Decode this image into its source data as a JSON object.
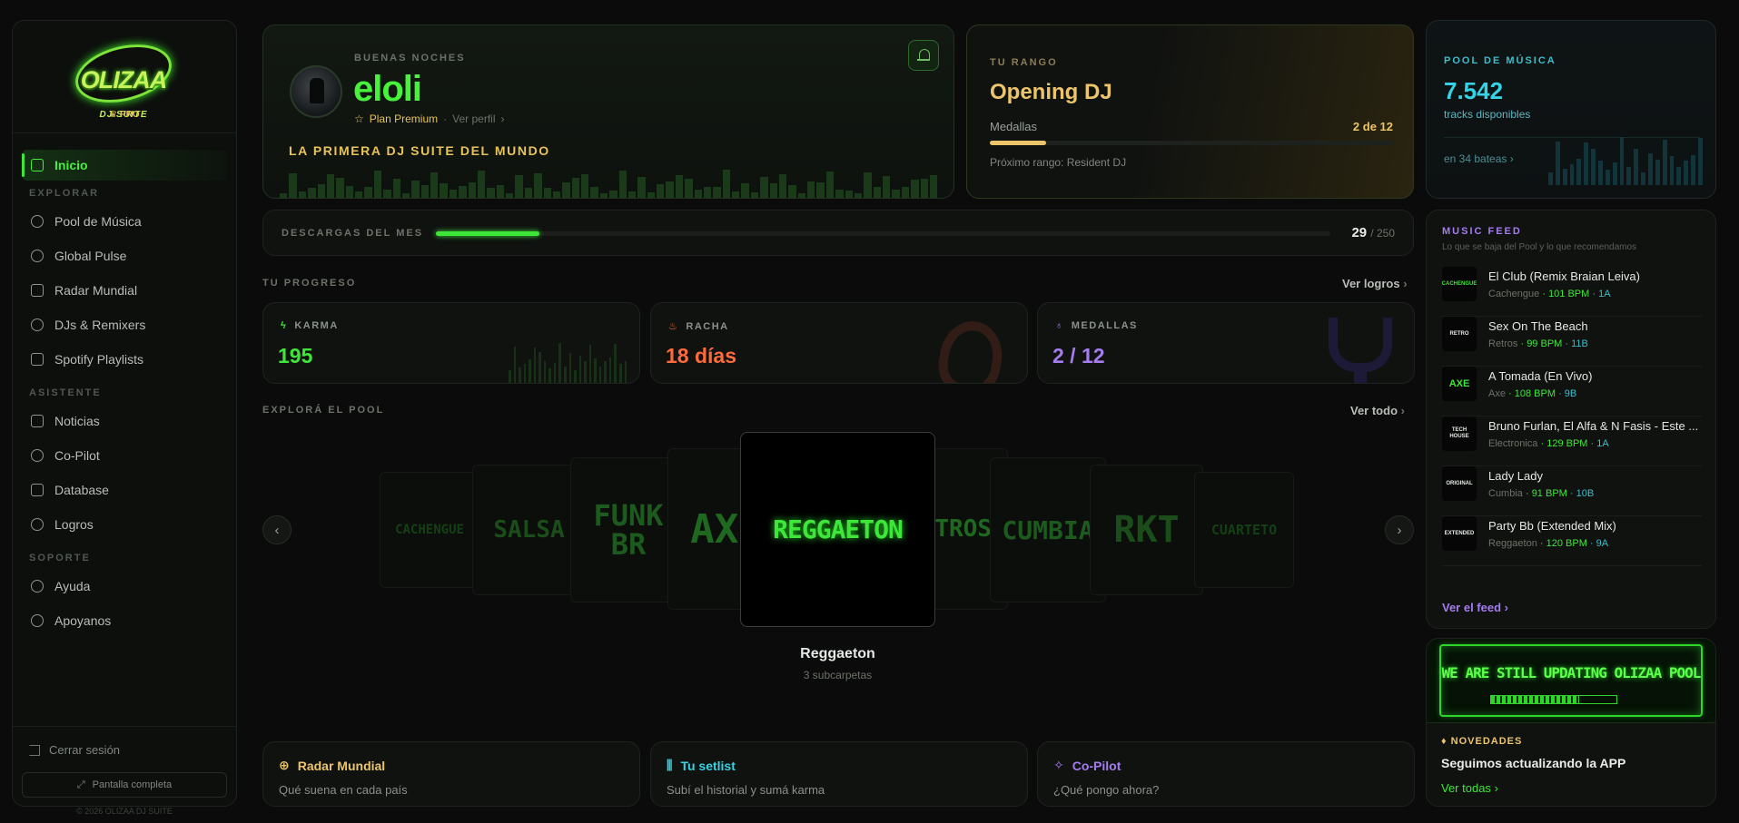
{
  "brand": {
    "logo_text": "OLIZAA",
    "logo_sub": "DJ SUITE",
    "tier": "♛ PRO"
  },
  "sidebar": {
    "active_item": "Inicio",
    "sections": {
      "explore": "EXPLORAR",
      "assistant": "ASISTENTE",
      "support": "SOPORTE"
    },
    "explore_items": [
      "Pool de Música",
      "Global Pulse",
      "Radar Mundial",
      "DJs & Remixers",
      "Spotify Playlists"
    ],
    "assistant_items": [
      "Noticias",
      "Co-Pilot",
      "Database",
      "Logros"
    ],
    "support_items": [
      "Ayuda",
      "Apoyanos"
    ],
    "logout": "Cerrar sesión",
    "fullscreen": "Pantalla completa",
    "copyright": "© 2026 OLIZAA DJ SUITE"
  },
  "hero": {
    "greeting": "BUENAS NOCHES",
    "username": "eloli",
    "plan": "Plan Premium",
    "plan_separator": "·",
    "profile_link": "Ver perfil",
    "tagline": "LA PRIMERA DJ SUITE DEL MUNDO"
  },
  "rank": {
    "label": "TU RANGO",
    "title": "Opening DJ",
    "medals_label": "Medallas",
    "medals_value": "2 de 12",
    "progress_fraction": 0.14,
    "next_rank": "Próximo rango: Resident DJ"
  },
  "pool": {
    "label": "POOL DE MÚSICA",
    "count": "7.542",
    "count_label": "tracks disponibles",
    "crates_link": "en 34 bateas"
  },
  "downloads": {
    "label": "DESCARGAS DEL MES",
    "current": "29",
    "total": "/ 250",
    "fraction": 0.116
  },
  "progress": {
    "title": "TU PROGRESO",
    "link": "Ver logros",
    "karma_label": "KARMA",
    "karma_value": "195",
    "streak_label": "RACHA",
    "streak_value": "18 días",
    "medals_label": "MEDALLAS",
    "medals_value": "2 / 12"
  },
  "explore_pool": {
    "title": "EXPLORÁ EL POOL",
    "link": "Ver todo",
    "genres": [
      "CACHENGUE",
      "SALSA",
      "FUNK BR",
      "AXE",
      "REGGAETON",
      "RETROS",
      "CUMBIA",
      "RKT",
      "CUARTETO"
    ],
    "selected_title": "Reggaeton",
    "selected_sub": "3 subcarpetas"
  },
  "quick_actions": [
    {
      "title": "Radar Mundial",
      "subtitle": "Qué suena en cada país"
    },
    {
      "title": "Tu setlist",
      "subtitle": "Subí el historial y sumá karma"
    },
    {
      "title": "Co-Pilot",
      "subtitle": "¿Qué pongo ahora?"
    }
  ],
  "feed": {
    "title": "MUSIC FEED",
    "subtitle": "Lo que se baja del Pool y lo que recomendamos",
    "items": [
      {
        "title": "El Club (Remix Braian Leiva)",
        "genre": "Cachengue",
        "bpm": "· 101 BPM",
        "key": "· 1A",
        "thumb": "CACHENGUE"
      },
      {
        "title": "Sex On The Beach",
        "genre": "Retros",
        "bpm": "· 99 BPM",
        "key": "· 11B",
        "thumb": "RETRO"
      },
      {
        "title": "A Tomada (En Vivo)",
        "genre": "Axe",
        "bpm": "· 108 BPM",
        "key": "· 9B",
        "thumb": "AXE"
      },
      {
        "title": "Bruno Furlan, El Alfa & N Fasis - Este ...",
        "genre": "Electronica",
        "bpm": "· 129 BPM",
        "key": "· 1A",
        "thumb": "TECH HOUSE"
      },
      {
        "title": "Lady Lady",
        "genre": "Cumbia",
        "bpm": "· 91 BPM",
        "key": "· 10B",
        "thumb": "ORIGINAL"
      },
      {
        "title": "Party Bb (Extended Mix)",
        "genre": "Reggaeton",
        "bpm": "· 120 BPM",
        "key": "· 9A",
        "thumb": "EXTENDED"
      }
    ],
    "link": "Ver el feed"
  },
  "news": {
    "image_text": "WE ARE STILL UPDATING OLIZAA POOL",
    "tag": "NOVEDADES",
    "title": "Seguimos actualizando la APP",
    "link": "Ver todas"
  },
  "colors": {
    "accent_green": "#3fe63a",
    "gold": "#ecc56a",
    "cyan": "#34d4e6",
    "purple": "#a57cf0",
    "streak_orange": "#ff6a3c"
  }
}
